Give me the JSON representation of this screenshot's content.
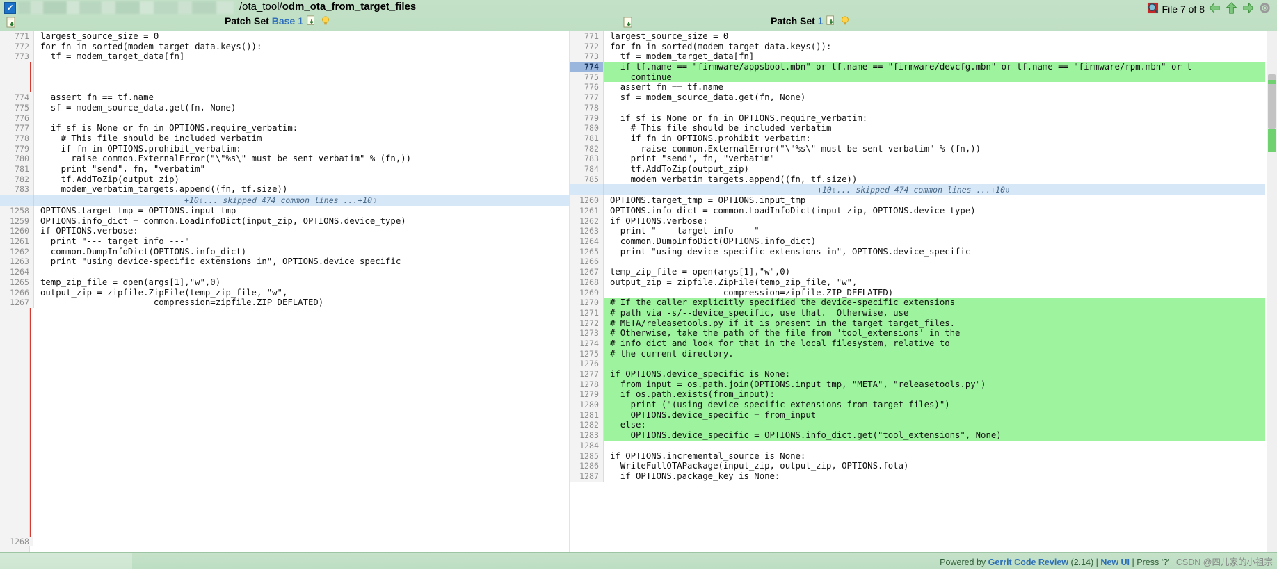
{
  "header": {
    "checkbox_glyph": "✔",
    "file_path_prefix": "/ota_tool/",
    "file_name": "odm_ota_from_target_files",
    "patchset_left_label": "Patch Set",
    "patchset_left_base": "Base",
    "patchset_left_value": "1",
    "patchset_right_label": "Patch Set",
    "patchset_right_value": "1",
    "file_counter": "File 7 of 8",
    "icons": {
      "download": "download-icon",
      "bulb": "lightbulb-icon",
      "prev_file": "arrow-left-icon",
      "up_file": "arrow-up-icon",
      "next_file": "arrow-right-icon",
      "settings": "gear-icon",
      "magnifier": "magnifier-icon"
    }
  },
  "skip_band": {
    "text": "+10⇧...  skipped 474 common lines ...+10⇩"
  },
  "left": {
    "rows": [
      {
        "n": "771",
        "t": "largest_source_size = 0"
      },
      {
        "n": "772",
        "t": "for fn in sorted(modem_target_data.keys()):"
      },
      {
        "n": "773",
        "t": "  tf = modem_target_data[fn]"
      },
      {
        "n": "",
        "t": ""
      },
      {
        "n": "",
        "t": ""
      },
      {
        "n": "",
        "t": ""
      },
      {
        "n": "774",
        "t": "  assert fn == tf.name"
      },
      {
        "n": "775",
        "t": "  sf = modem_source_data.get(fn, None)"
      },
      {
        "n": "776",
        "t": ""
      },
      {
        "n": "777",
        "t": "  if sf is None or fn in OPTIONS.require_verbatim:"
      },
      {
        "n": "778",
        "t": "    # This file should be included verbatim"
      },
      {
        "n": "779",
        "t": "    if fn in OPTIONS.prohibit_verbatim:"
      },
      {
        "n": "780",
        "t": "      raise common.ExternalError(\"\\\"%s\\\" must be sent verbatim\" % (fn,))"
      },
      {
        "n": "781",
        "t": "    print \"send\", fn, \"verbatim\""
      },
      {
        "n": "782",
        "t": "    tf.AddToZip(output_zip)"
      },
      {
        "n": "783",
        "t": "    modem_verbatim_targets.append((fn, tf.size))"
      }
    ],
    "rows2": [
      {
        "n": "1258",
        "t": "OPTIONS.target_tmp = OPTIONS.input_tmp"
      },
      {
        "n": "1259",
        "t": "OPTIONS.info_dict = common.LoadInfoDict(input_zip, OPTIONS.device_type)"
      },
      {
        "n": "1260",
        "t": "if OPTIONS.verbose:"
      },
      {
        "n": "1261",
        "t": "  print \"--- target info ---\""
      },
      {
        "n": "1262",
        "t": "  common.DumpInfoDict(OPTIONS.info_dict)"
      },
      {
        "n": "1263",
        "t": "  print \"using device-specific extensions in\", OPTIONS.device_specific"
      },
      {
        "n": "1264",
        "t": ""
      },
      {
        "n": "1265",
        "t": "temp_zip_file = open(args[1],\"w\",0)"
      },
      {
        "n": "1266",
        "t": "output_zip = zipfile.ZipFile(temp_zip_file, \"w\","
      },
      {
        "n": "1267",
        "t": "                      compression=zipfile.ZIP_DEFLATED)"
      }
    ],
    "tail_line_number": "1268"
  },
  "right": {
    "rows": [
      {
        "n": "771",
        "t": "largest_source_size = 0",
        "state": "ctx"
      },
      {
        "n": "772",
        "t": "for fn in sorted(modem_target_data.keys()):",
        "state": "ctx"
      },
      {
        "n": "773",
        "t": "  tf = modem_target_data[fn]",
        "state": "ctx"
      },
      {
        "n": "774",
        "t": "  if tf.name == \"firmware/appsboot.mbn\" or tf.name == \"firmware/devcfg.mbn\" or tf.name == \"firmware/rpm.mbn\" or t",
        "state": "added cursor"
      },
      {
        "n": "775",
        "t": "    continue",
        "state": "added"
      },
      {
        "n": "776",
        "t": "  assert fn == tf.name",
        "state": "ctx"
      },
      {
        "n": "777",
        "t": "  sf = modem_source_data.get(fn, None)",
        "state": "ctx"
      },
      {
        "n": "778",
        "t": "",
        "state": "ctx"
      },
      {
        "n": "779",
        "t": "  if sf is None or fn in OPTIONS.require_verbatim:",
        "state": "ctx"
      },
      {
        "n": "780",
        "t": "    # This file should be included verbatim",
        "state": "ctx"
      },
      {
        "n": "781",
        "t": "    if fn in OPTIONS.prohibit_verbatim:",
        "state": "ctx"
      },
      {
        "n": "782",
        "t": "      raise common.ExternalError(\"\\\"%s\\\" must be sent verbatim\" % (fn,))",
        "state": "ctx"
      },
      {
        "n": "783",
        "t": "    print \"send\", fn, \"verbatim\"",
        "state": "ctx"
      },
      {
        "n": "784",
        "t": "    tf.AddToZip(output_zip)",
        "state": "ctx"
      },
      {
        "n": "785",
        "t": "    modem_verbatim_targets.append((fn, tf.size))",
        "state": "ctx"
      }
    ],
    "rows2": [
      {
        "n": "1260",
        "t": "OPTIONS.target_tmp = OPTIONS.input_tmp",
        "state": "ctx"
      },
      {
        "n": "1261",
        "t": "OPTIONS.info_dict = common.LoadInfoDict(input_zip, OPTIONS.device_type)",
        "state": "ctx"
      },
      {
        "n": "1262",
        "t": "if OPTIONS.verbose:",
        "state": "ctx"
      },
      {
        "n": "1263",
        "t": "  print \"--- target info ---\"",
        "state": "ctx"
      },
      {
        "n": "1264",
        "t": "  common.DumpInfoDict(OPTIONS.info_dict)",
        "state": "ctx"
      },
      {
        "n": "1265",
        "t": "  print \"using device-specific extensions in\", OPTIONS.device_specific",
        "state": "ctx"
      },
      {
        "n": "1266",
        "t": "",
        "state": "ctx"
      },
      {
        "n": "1267",
        "t": "temp_zip_file = open(args[1],\"w\",0)",
        "state": "ctx"
      },
      {
        "n": "1268",
        "t": "output_zip = zipfile.ZipFile(temp_zip_file, \"w\",",
        "state": "ctx"
      },
      {
        "n": "1269",
        "t": "                      compression=zipfile.ZIP_DEFLATED)",
        "state": "ctx"
      },
      {
        "n": "1270",
        "t": "# If the caller explicitly specified the device-specific extensions",
        "state": "added"
      },
      {
        "n": "1271",
        "t": "# path via -s/--device_specific, use that.  Otherwise, use",
        "state": "added"
      },
      {
        "n": "1272",
        "t": "# META/releasetools.py if it is present in the target target_files.",
        "state": "added"
      },
      {
        "n": "1273",
        "t": "# Otherwise, take the path of the file from 'tool_extensions' in the",
        "state": "added"
      },
      {
        "n": "1274",
        "t": "# info dict and look for that in the local filesystem, relative to",
        "state": "added"
      },
      {
        "n": "1275",
        "t": "# the current directory.",
        "state": "added"
      },
      {
        "n": "1276",
        "t": "",
        "state": "added"
      },
      {
        "n": "1277",
        "t": "if OPTIONS.device_specific is None:",
        "state": "added"
      },
      {
        "n": "1278",
        "t": "  from_input = os.path.join(OPTIONS.input_tmp, \"META\", \"releasetools.py\")",
        "state": "added"
      },
      {
        "n": "1279",
        "t": "  if os.path.exists(from_input):",
        "state": "added"
      },
      {
        "n": "1280",
        "t": "    print (\"(using device-specific extensions from target_files)\")",
        "state": "added"
      },
      {
        "n": "1281",
        "t": "    OPTIONS.device_specific = from_input",
        "state": "added"
      },
      {
        "n": "1282",
        "t": "  else:",
        "state": "added"
      },
      {
        "n": "1283",
        "t": "    OPTIONS.device_specific = OPTIONS.info_dict.get(\"tool_extensions\", None)",
        "state": "added"
      },
      {
        "n": "1284",
        "t": "",
        "state": "ctx"
      },
      {
        "n": "1285",
        "t": "if OPTIONS.incremental_source is None:",
        "state": "ctx"
      },
      {
        "n": "1286",
        "t": "  WriteFullOTAPackage(input_zip, output_zip, OPTIONS.fota)",
        "state": "ctx"
      },
      {
        "n": "1287",
        "t": "  if OPTIONS.package_key is None:",
        "state": "ctx"
      }
    ]
  },
  "footer": {
    "powered_by": "Powered by",
    "brand": "Gerrit Code Review",
    "version": "(2.14)",
    "separator": "|",
    "new_ui": "New UI",
    "press_hint": "Press '?'",
    "watermark": "CSDN @四儿家的小祖宗"
  },
  "colors": {
    "added_bg": "#9ef49e",
    "header_bg": "#c2e0c6",
    "skip_bg": "#d6e7f8",
    "cursor_ln_bg": "#9ab6dd",
    "deleted_marker": "#d43a2f",
    "link": "#2d6fb7"
  }
}
